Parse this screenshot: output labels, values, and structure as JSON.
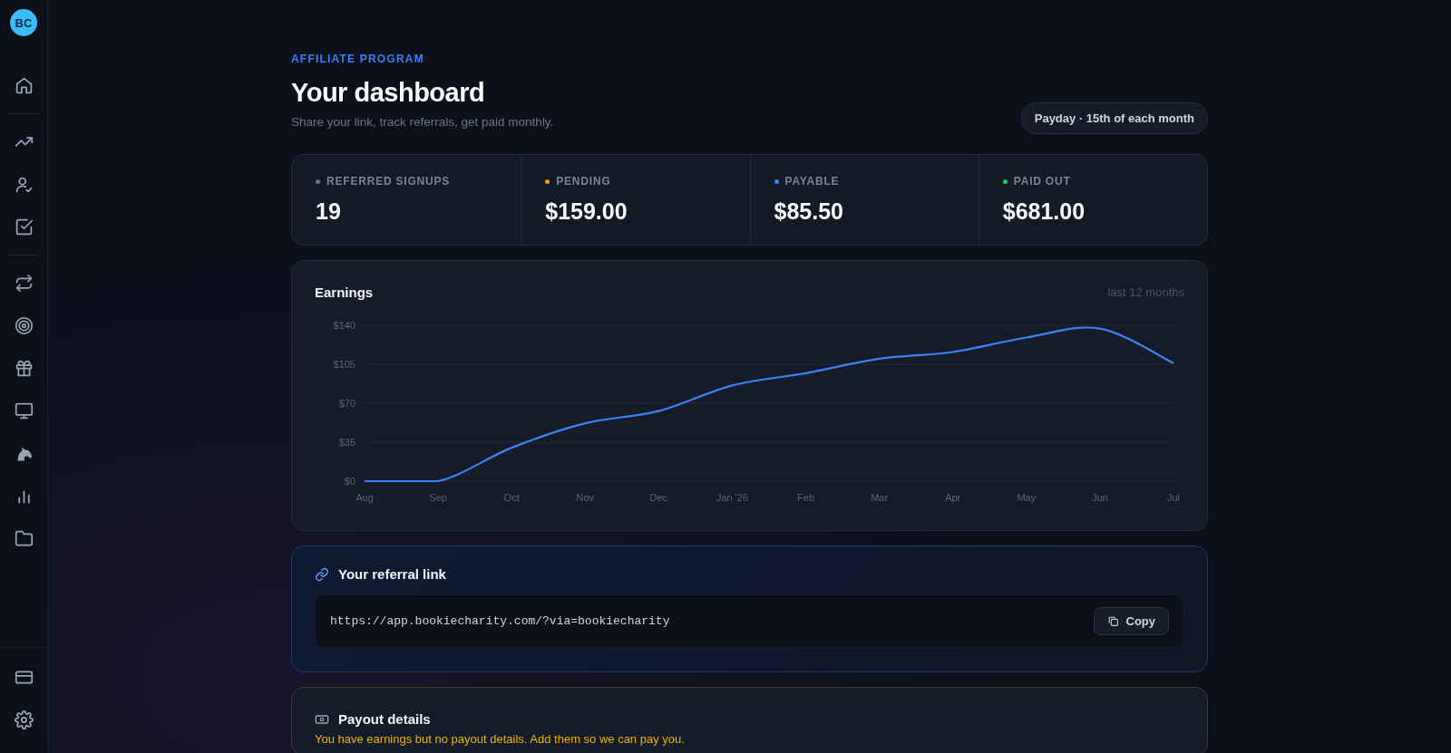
{
  "sidebar": {
    "sections": [
      {
        "items": [
          {
            "kind": "home"
          }
        ]
      },
      {
        "items": [
          {
            "kind": "trend"
          },
          {
            "kind": "user-check"
          },
          {
            "kind": "checkbox"
          }
        ]
      },
      {
        "items": [
          {
            "kind": "repeat"
          },
          {
            "kind": "target"
          },
          {
            "kind": "gift"
          },
          {
            "kind": "monitor"
          },
          {
            "kind": "horse"
          },
          {
            "kind": "bars"
          },
          {
            "kind": "folder"
          }
        ]
      }
    ],
    "bottom": [
      {
        "kind": "card"
      },
      {
        "kind": "gear"
      }
    ],
    "logo": "BC"
  },
  "header": {
    "eyebrow": "AFFILIATE PROGRAM",
    "title": "Your dashboard",
    "subtitle": "Share your link, track referrals, get paid monthly.",
    "badge": "Payday · 15th of each month"
  },
  "stats": [
    {
      "label": "REFERRED SIGNUPS",
      "value": "19",
      "color": "#6b7280"
    },
    {
      "label": "PENDING",
      "value": "$159.00",
      "color": "#f59e0b"
    },
    {
      "label": "PAYABLE",
      "value": "$85.50",
      "color": "#3b82f6"
    },
    {
      "label": "PAID OUT",
      "value": "$681.00",
      "color": "#22c55e"
    }
  ],
  "earnings": {
    "title": "Earnings",
    "range": "last 12 months",
    "chart_data": {
      "type": "line",
      "categories": [
        "Aug",
        "Sep",
        "Oct",
        "Nov",
        "Dec",
        "Jan '26",
        "Feb",
        "Mar",
        "Apr",
        "May",
        "Jun",
        "Jul"
      ],
      "series": [
        {
          "color": "#3b82f6",
          "values": [
            0,
            0,
            30,
            52,
            63,
            86,
            97,
            110,
            116,
            129,
            137,
            106
          ]
        }
      ],
      "ylim": [
        0,
        140
      ],
      "grid": true,
      "yticks": [
        {
          "value": 0,
          "label": "$0"
        },
        {
          "value": 35,
          "label": "$35"
        },
        {
          "value": 70,
          "label": "$70"
        },
        {
          "value": 105,
          "label": "$105"
        },
        {
          "value": 140,
          "label": "$140"
        }
      ]
    }
  },
  "referral": {
    "title": "Your referral link",
    "url": "https://app.bookiecharity.com/?via=bookiecharity",
    "button": "Copy"
  },
  "payout": {
    "title": "Payout details",
    "warning": "You have earnings but no payout details. Add them so we can pay you."
  }
}
